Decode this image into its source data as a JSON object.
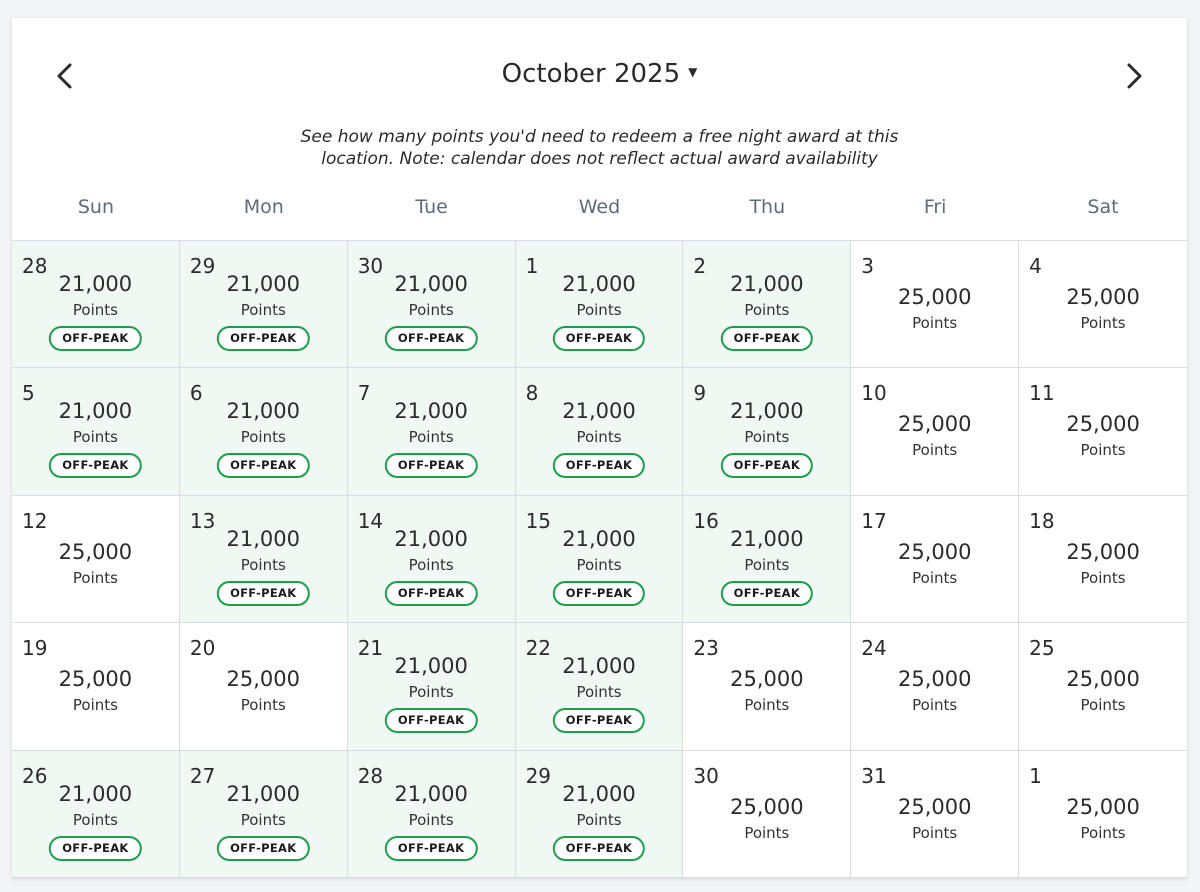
{
  "header": {
    "month_label": "October 2025",
    "prev_icon": "chevron-left-icon",
    "next_icon": "chevron-right-icon",
    "caret_icon": "caret-down-icon"
  },
  "note": {
    "line1": "See how many points you'd need to redeem a free night award at this",
    "line2": "location. Note: calendar does not reflect actual award availability"
  },
  "weekdays": [
    "Sun",
    "Mon",
    "Tue",
    "Wed",
    "Thu",
    "Fri",
    "Sat"
  ],
  "colors": {
    "offpeak_bg": "#f0f8f4",
    "badge_border": "#1e9e4a",
    "weekday_text": "#5f6b7a",
    "grid_line": "#d9dce0"
  },
  "points_label": "Points",
  "badge_label": "OFF-PEAK",
  "days": [
    {
      "day": "28",
      "points": "21,000",
      "offpeak": true
    },
    {
      "day": "29",
      "points": "21,000",
      "offpeak": true
    },
    {
      "day": "30",
      "points": "21,000",
      "offpeak": true
    },
    {
      "day": "1",
      "points": "21,000",
      "offpeak": true
    },
    {
      "day": "2",
      "points": "21,000",
      "offpeak": true
    },
    {
      "day": "3",
      "points": "25,000",
      "offpeak": false
    },
    {
      "day": "4",
      "points": "25,000",
      "offpeak": false
    },
    {
      "day": "5",
      "points": "21,000",
      "offpeak": true
    },
    {
      "day": "6",
      "points": "21,000",
      "offpeak": true
    },
    {
      "day": "7",
      "points": "21,000",
      "offpeak": true
    },
    {
      "day": "8",
      "points": "21,000",
      "offpeak": true
    },
    {
      "day": "9",
      "points": "21,000",
      "offpeak": true
    },
    {
      "day": "10",
      "points": "25,000",
      "offpeak": false
    },
    {
      "day": "11",
      "points": "25,000",
      "offpeak": false
    },
    {
      "day": "12",
      "points": "25,000",
      "offpeak": false
    },
    {
      "day": "13",
      "points": "21,000",
      "offpeak": true
    },
    {
      "day": "14",
      "points": "21,000",
      "offpeak": true
    },
    {
      "day": "15",
      "points": "21,000",
      "offpeak": true
    },
    {
      "day": "16",
      "points": "21,000",
      "offpeak": true
    },
    {
      "day": "17",
      "points": "25,000",
      "offpeak": false
    },
    {
      "day": "18",
      "points": "25,000",
      "offpeak": false
    },
    {
      "day": "19",
      "points": "25,000",
      "offpeak": false
    },
    {
      "day": "20",
      "points": "25,000",
      "offpeak": false
    },
    {
      "day": "21",
      "points": "21,000",
      "offpeak": true
    },
    {
      "day": "22",
      "points": "21,000",
      "offpeak": true
    },
    {
      "day": "23",
      "points": "25,000",
      "offpeak": false
    },
    {
      "day": "24",
      "points": "25,000",
      "offpeak": false
    },
    {
      "day": "25",
      "points": "25,000",
      "offpeak": false
    },
    {
      "day": "26",
      "points": "21,000",
      "offpeak": true
    },
    {
      "day": "27",
      "points": "21,000",
      "offpeak": true
    },
    {
      "day": "28",
      "points": "21,000",
      "offpeak": true
    },
    {
      "day": "29",
      "points": "21,000",
      "offpeak": true
    },
    {
      "day": "30",
      "points": "25,000",
      "offpeak": false
    },
    {
      "day": "31",
      "points": "25,000",
      "offpeak": false
    },
    {
      "day": "1",
      "points": "25,000",
      "offpeak": false
    }
  ]
}
